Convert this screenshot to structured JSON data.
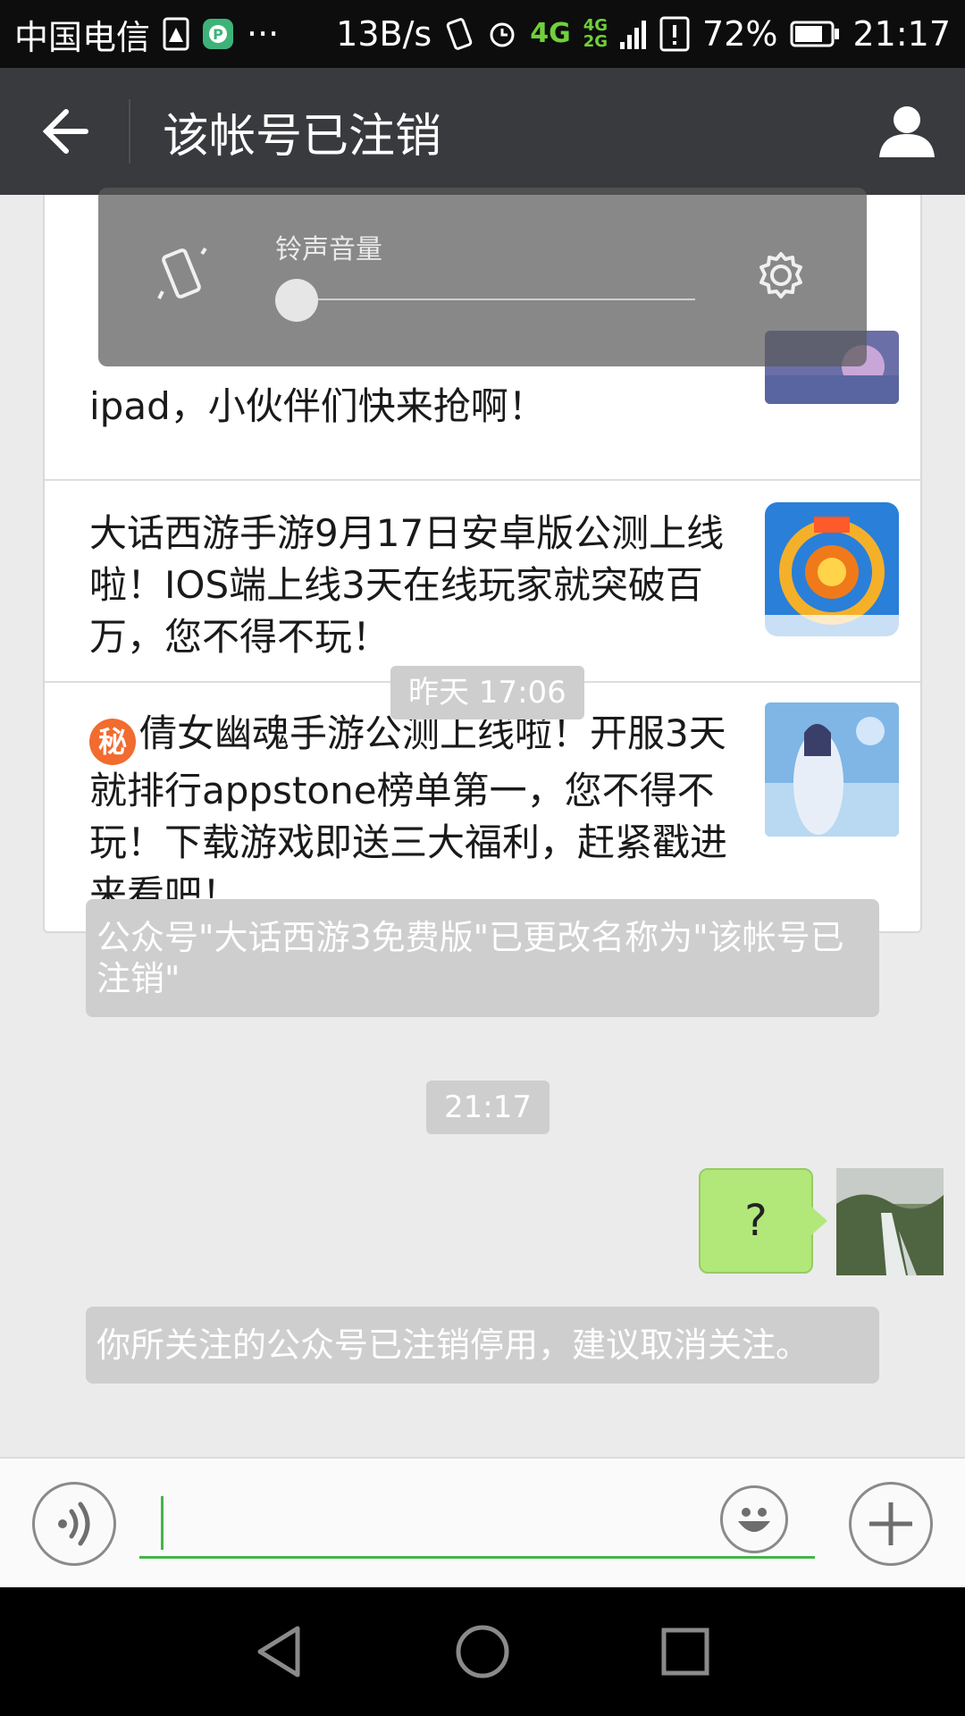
{
  "status_bar": {
    "carrier": "中国电信",
    "more": "···",
    "speed": "13B/s",
    "network_primary": "4G",
    "network_secondary": [
      "4G",
      "2G"
    ],
    "battery": "72%",
    "time": "21:17"
  },
  "header": {
    "title": "该帐号已注销"
  },
  "news": [
    {
      "text": "ipad，小伙伴们快来抢啊！",
      "thumb": "game-ipad-thumb"
    },
    {
      "text": "大话西游手游9月17日安卓版公测上线啦！IOS端上线3天在线玩家就突破百万，您不得不玩！",
      "thumb": "dahua-xiyou-logo-thumb"
    },
    {
      "badge": "秘",
      "text": "倩女幽魂手游公测上线啦！开服3天就排行appstone榜单第一，您不得不玩！下载游戏即送三大福利，赶紧戳进来看吧！",
      "thumb": "qiannv-youhun-thumb"
    }
  ],
  "messages": {
    "time1": "昨天 17:06",
    "system1": "公众号\"大话西游3免费版\"已更改名称为\"该帐号已注销\"",
    "time2": "21:17",
    "user_bubble": "?",
    "system2": "你所关注的公众号已注销停用，建议取消关注。"
  },
  "volume_popup": {
    "label": "铃声音量",
    "level": 0
  },
  "input": {
    "value": "",
    "placeholder": ""
  },
  "colors": {
    "title_bar": "#393a3e",
    "accent_green": "#44b549",
    "bubble_green": "#b2e87a",
    "chat_bg": "#ebebeb",
    "system_msg_bg": "#cecece"
  },
  "icons": {
    "back": "arrow-left-icon",
    "profile": "person-icon",
    "voice": "voice-wave-icon",
    "emoji": "smiley-icon",
    "plus": "plus-icon",
    "vibrate": "vibrate-phone-icon",
    "settings": "gear-icon"
  }
}
